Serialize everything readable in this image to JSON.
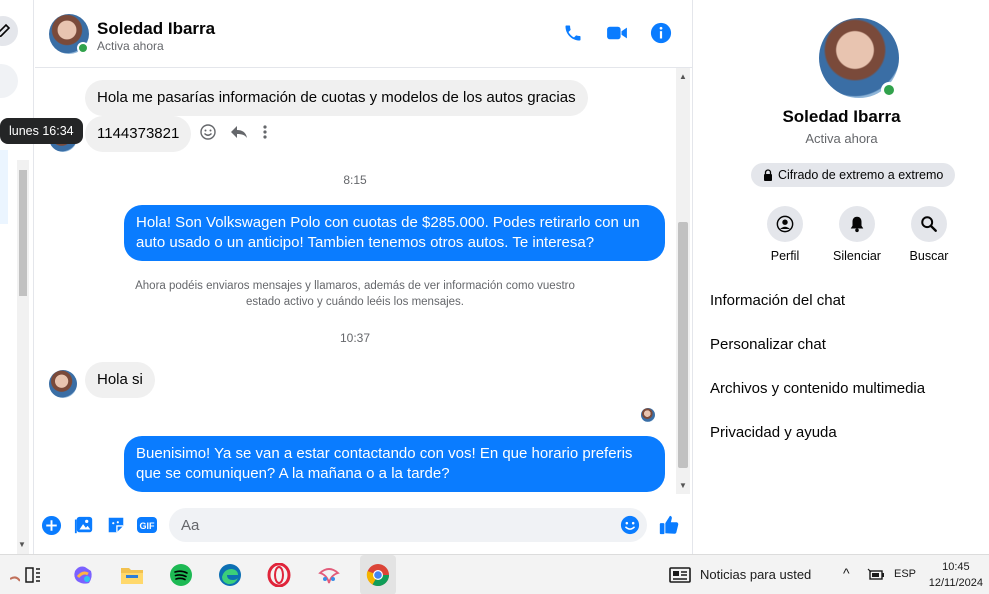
{
  "contact": {
    "name": "Soledad Ibarra",
    "status": "Activa ahora"
  },
  "messages": {
    "m1": "Hola me pasarías información de cuotas y modelos de los autos gracias",
    "m2": "1144373821",
    "tooltip": "lunes 16:34",
    "ts1": "8:15",
    "m3": "Hola! Son Volkswagen Polo con cuotas de $285.000. Podes retirarlo con un auto usado o un anticipo! Tambien tenemos otros autos. Te interesa?",
    "notice": "Ahora podéis enviaros mensajes y llamaros, además de ver información como vuestro estado activo y cuándo leéis los mensajes.",
    "ts2": "10:37",
    "m4": "Hola si",
    "m5": "Buenisimo! Ya se van a estar contactando con vos! En que horario preferis que se comuniquen? A la mañana o a la tarde?"
  },
  "composer": {
    "placeholder": "Aa"
  },
  "panel": {
    "encryption": "Cifrado de extremo a extremo",
    "actions": [
      "Perfil",
      "Silenciar",
      "Buscar"
    ],
    "menu": [
      "Información del chat",
      "Personalizar chat",
      "Archivos y contenido multimedia",
      "Privacidad y ayuda"
    ]
  },
  "taskbar": {
    "news": "Noticias para usted",
    "lang": "ESP",
    "time": "10:45",
    "date": "12/11/2024"
  },
  "colors": {
    "accent": "#0a7cff",
    "online": "#31a24c"
  }
}
